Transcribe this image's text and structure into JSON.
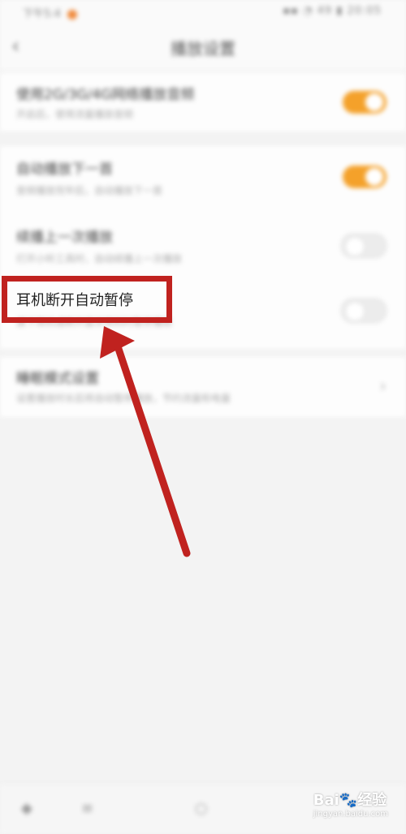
{
  "status": {
    "time": "下午5:4",
    "right": "▪︎▪︎ ◔ 49 ▮ 20:05"
  },
  "header": {
    "title": "播放设置",
    "back_icon": "chevron-left-icon"
  },
  "rows": [
    {
      "title": "使用2G/3G/4G网络播放音频",
      "desc": "开启后，使用流量播放音频",
      "toggle": "on"
    },
    {
      "title": "自动播放下一首",
      "desc": "音频播放完毕后，自动播放下一首",
      "toggle": "on"
    },
    {
      "title": "续播上一次播放",
      "desc": "打开小听工具时，自动续播上一次播放",
      "toggle": "off"
    },
    {
      "title": "耳机断开自动暂停",
      "desc": "拔下耳机或断开蓝牙耳机时暂停播放",
      "toggle": "off"
    },
    {
      "title": "睡眠模式设置",
      "desc": "设置播放时长后将自动暂停播放，节约流量和电量",
      "toggle": "chevron"
    }
  ],
  "highlight": {
    "label": "耳机断开自动暂停"
  },
  "watermark": {
    "brand": "Bai",
    "brand2": "经验",
    "sub": "jingyan.baidu.com"
  },
  "colors": {
    "accent": "#f4a12a",
    "annotation": "#c0221f"
  }
}
